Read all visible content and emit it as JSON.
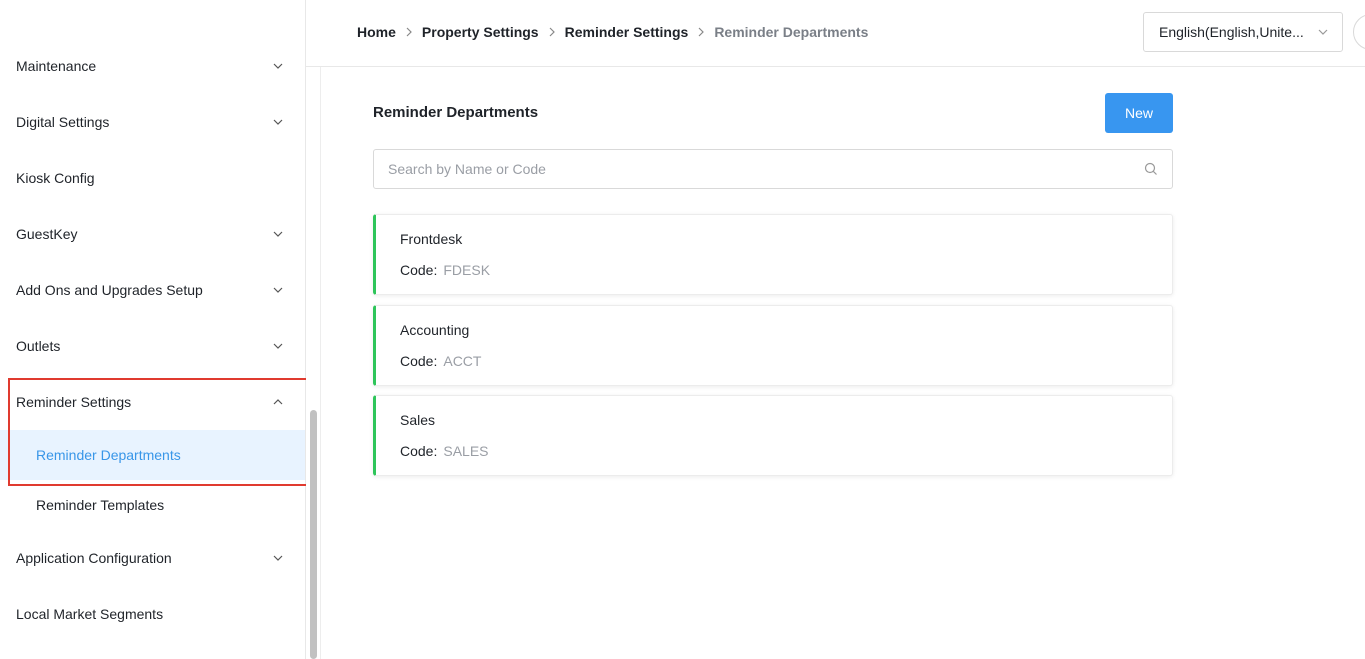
{
  "breadcrumb": {
    "home": "Home",
    "property_settings": "Property Settings",
    "reminder_settings": "Reminder Settings",
    "current": "Reminder Departments"
  },
  "language_select": {
    "value": "English(English,Unite..."
  },
  "sidebar": {
    "items": [
      {
        "label": "Maintenance",
        "expanded": false
      },
      {
        "label": "Digital Settings",
        "expanded": false
      },
      {
        "label": "Kiosk Config"
      },
      {
        "label": "GuestKey",
        "expanded": false
      },
      {
        "label": "Add Ons and Upgrades Setup",
        "expanded": false
      },
      {
        "label": "Outlets",
        "expanded": false
      },
      {
        "label": "Reminder Settings",
        "expanded": true
      },
      {
        "label": "Application Configuration",
        "expanded": false
      },
      {
        "label": "Local Market Segments"
      }
    ],
    "reminder_sub": [
      {
        "label": "Reminder Departments",
        "active": true
      },
      {
        "label": "Reminder Templates",
        "active": false
      }
    ]
  },
  "main": {
    "title": "Reminder Departments",
    "new_label": "New",
    "search_placeholder": "Search by Name or Code",
    "code_label": "Code:",
    "departments": [
      {
        "name": "Frontdesk",
        "code": "FDESK"
      },
      {
        "name": "Accounting",
        "code": "ACCT"
      },
      {
        "name": "Sales",
        "code": "SALES"
      }
    ]
  },
  "colors": {
    "accent": "#3896f0",
    "active_bg": "#e8f3ff",
    "active_text": "#3896e8",
    "card_accent": "#2ec55a",
    "highlight_border": "#e03a2f"
  }
}
